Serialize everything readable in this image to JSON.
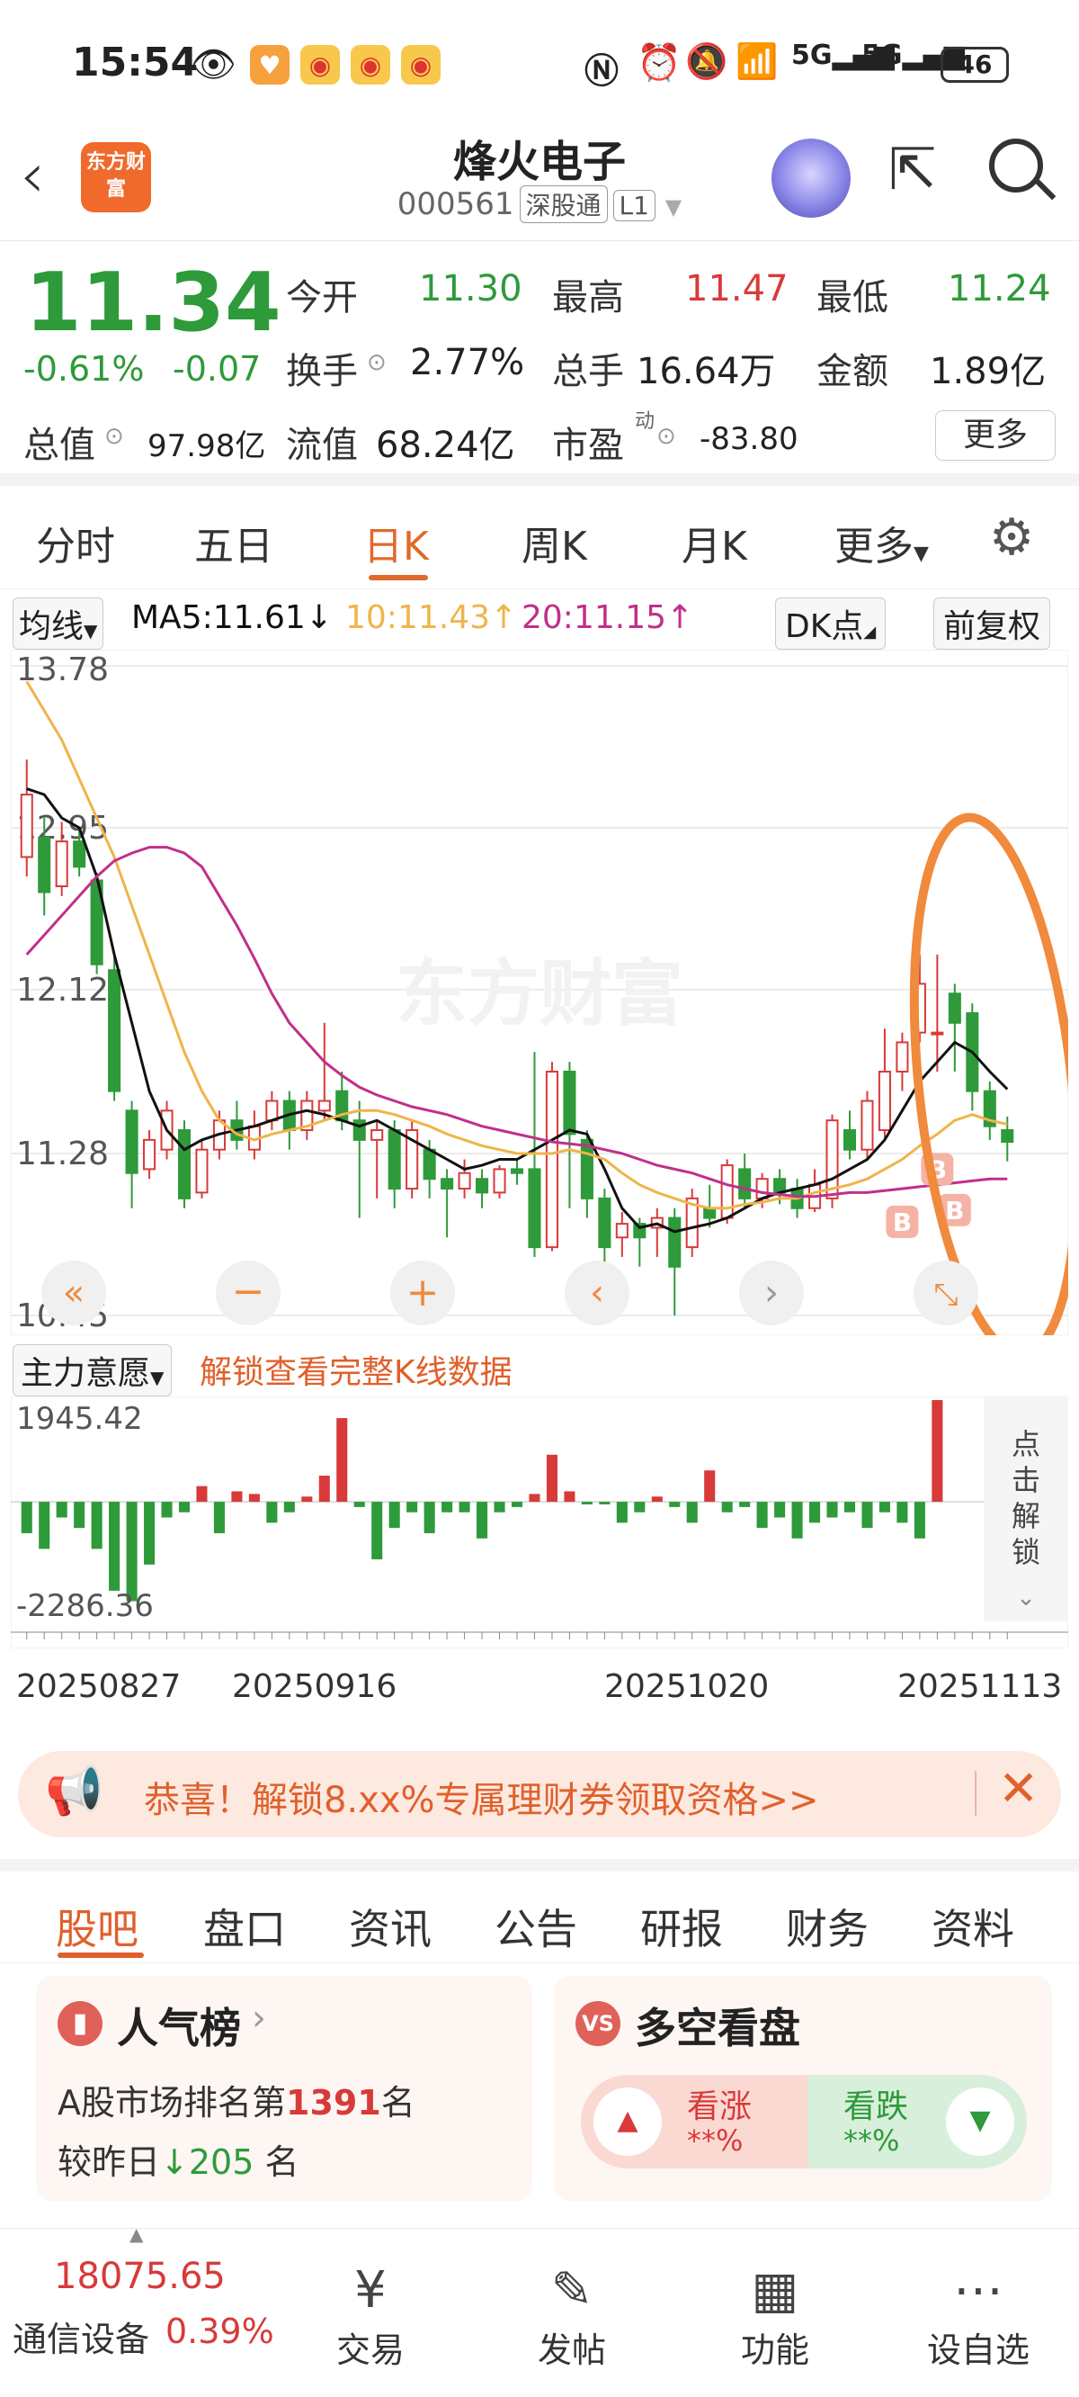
{
  "status_bar": {
    "time": "15:54",
    "battery": "46"
  },
  "header": {
    "stock_name": "烽火电子",
    "stock_code": "000561",
    "tag_connect": "深股通",
    "tag_level": "L1",
    "logo_text": "东方财富"
  },
  "quote": {
    "price": "11.34",
    "change_pct": "-0.61%",
    "change_abs": "-0.07",
    "open_label": "今开",
    "open": "11.30",
    "high_label": "最高",
    "high": "11.47",
    "low_label": "最低",
    "low": "11.24",
    "turnover_label": "换手",
    "turnover": "2.77%",
    "volume_label": "总手",
    "volume": "16.64万",
    "amount_label": "金额",
    "amount": "1.89亿",
    "mktcap_label": "总值",
    "mktcap": "97.98亿",
    "float_label": "流值",
    "float_cap": "68.24亿",
    "pe_label": "市盈",
    "pe_sup": "动",
    "pe": "-83.80",
    "more_label": "更多"
  },
  "kline_tabs": [
    "分时",
    "五日",
    "日K",
    "周K",
    "月K",
    "更多"
  ],
  "ma_bar": {
    "ma_type": "均线",
    "ma5": "MA5:11.61",
    "ma10": "10:11.43",
    "ma20": "20:11.15",
    "dk": "DK点",
    "adjust": "前复权"
  },
  "watermark": "东方财富",
  "sub_bar": {
    "indicator": "主力意愿",
    "unlock": "解锁查看完整K线数据"
  },
  "side_unlock": "点击解锁",
  "x_labels": [
    "20250827",
    "20250916",
    "20251020",
    "20251113"
  ],
  "chart_data": {
    "type": "candlestick",
    "y_ticks": [
      "13.78",
      "12.95",
      "12.12",
      "11.28",
      "10.45"
    ],
    "ylim": [
      10.45,
      13.78
    ],
    "candles": [
      [
        12.8,
        13.12,
        13.3,
        12.7
      ],
      [
        12.9,
        12.62,
        13.0,
        12.5
      ],
      [
        12.65,
        12.88,
        12.98,
        12.6
      ],
      [
        12.88,
        12.75,
        12.95,
        12.7
      ],
      [
        12.68,
        12.25,
        12.72,
        12.2
      ],
      [
        12.22,
        11.6,
        12.3,
        11.55
      ],
      [
        11.5,
        11.18,
        11.55,
        11.0
      ],
      [
        11.2,
        11.35,
        11.4,
        11.15
      ],
      [
        11.3,
        11.5,
        11.55,
        11.25
      ],
      [
        11.4,
        11.05,
        11.45,
        11.0
      ],
      [
        11.08,
        11.3,
        11.35,
        11.05
      ],
      [
        11.3,
        11.45,
        11.5,
        11.25
      ],
      [
        11.45,
        11.35,
        11.55,
        11.3
      ],
      [
        11.3,
        11.42,
        11.5,
        11.25
      ],
      [
        11.45,
        11.55,
        11.6,
        11.4
      ],
      [
        11.55,
        11.4,
        11.6,
        11.3
      ],
      [
        11.4,
        11.55,
        11.6,
        11.35
      ],
      [
        11.5,
        11.55,
        11.95,
        11.45
      ],
      [
        11.6,
        11.45,
        11.7,
        11.4
      ],
      [
        11.45,
        11.35,
        11.55,
        10.95
      ],
      [
        11.35,
        11.4,
        11.45,
        11.05
      ],
      [
        11.4,
        11.1,
        11.45,
        11.0
      ],
      [
        11.1,
        11.4,
        11.45,
        11.05
      ],
      [
        11.3,
        11.15,
        11.35,
        11.05
      ],
      [
        11.15,
        11.1,
        11.2,
        10.85
      ],
      [
        11.1,
        11.18,
        11.25,
        11.05
      ],
      [
        11.15,
        11.08,
        11.2,
        11.0
      ],
      [
        11.08,
        11.2,
        11.22,
        11.05
      ],
      [
        11.2,
        11.18,
        11.25,
        11.12
      ],
      [
        11.2,
        10.8,
        11.8,
        10.75
      ],
      [
        10.8,
        11.7,
        11.75,
        10.78
      ],
      [
        11.7,
        11.38,
        11.75,
        11.0
      ],
      [
        11.35,
        11.05,
        11.4,
        10.95
      ],
      [
        11.05,
        10.8,
        11.1,
        10.7
      ],
      [
        10.85,
        10.92,
        10.98,
        10.75
      ],
      [
        10.92,
        10.85,
        10.95,
        10.7
      ],
      [
        10.9,
        10.95,
        11.0,
        10.75
      ],
      [
        10.95,
        10.7,
        11.0,
        10.45
      ],
      [
        10.8,
        11.05,
        11.1,
        10.75
      ],
      [
        11.0,
        10.95,
        11.12,
        10.9
      ],
      [
        10.95,
        11.22,
        11.25,
        10.92
      ],
      [
        11.2,
        11.05,
        11.28,
        11.0
      ],
      [
        11.05,
        11.15,
        11.18,
        11.0
      ],
      [
        11.15,
        11.08,
        11.2,
        11.02
      ],
      [
        11.1,
        11.0,
        11.15,
        10.95
      ],
      [
        11.0,
        11.12,
        11.2,
        10.98
      ],
      [
        11.05,
        11.45,
        11.48,
        11.0
      ],
      [
        11.4,
        11.3,
        11.5,
        11.25
      ],
      [
        11.3,
        11.55,
        11.6,
        11.25
      ],
      [
        11.4,
        11.7,
        11.92,
        11.35
      ],
      [
        11.7,
        11.85,
        11.9,
        11.6
      ],
      [
        11.9,
        12.15,
        12.3,
        11.85
      ],
      [
        11.9,
        11.9,
        12.3,
        11.7
      ],
      [
        12.1,
        11.95,
        12.15,
        11.7
      ],
      [
        12.0,
        11.6,
        12.05,
        11.5
      ],
      [
        11.6,
        11.42,
        11.65,
        11.35
      ],
      [
        11.4,
        11.34,
        11.47,
        11.24
      ]
    ],
    "ma5_line": [
      13.15,
      13.12,
      13.0,
      12.95,
      12.7,
      12.3,
      11.95,
      11.6,
      11.4,
      11.3,
      11.35,
      11.38,
      11.4,
      11.42,
      11.45,
      11.48,
      11.5,
      11.48,
      11.45,
      11.42,
      11.45,
      11.4,
      11.35,
      11.3,
      11.25,
      11.2,
      11.22,
      11.25,
      11.25,
      11.3,
      11.35,
      11.4,
      11.38,
      11.2,
      11.0,
      10.9,
      10.92,
      10.88,
      10.9,
      10.92,
      10.95,
      11.0,
      11.05,
      11.08,
      11.1,
      11.12,
      11.15,
      11.2,
      11.25,
      11.35,
      11.5,
      11.65,
      11.75,
      11.85,
      11.8,
      11.7,
      11.61
    ],
    "ma10_line": [
      13.7,
      13.55,
      13.4,
      13.2,
      13.0,
      12.8,
      12.55,
      12.3,
      12.05,
      11.8,
      11.6,
      11.45,
      11.38,
      11.35,
      11.38,
      11.4,
      11.42,
      11.45,
      11.48,
      11.5,
      11.5,
      11.48,
      11.45,
      11.42,
      11.38,
      11.35,
      11.32,
      11.3,
      11.28,
      11.28,
      11.28,
      11.3,
      11.28,
      11.25,
      11.18,
      11.12,
      11.08,
      11.05,
      11.02,
      11.0,
      11.0,
      11.02,
      11.03,
      11.05,
      11.05,
      11.08,
      11.1,
      11.12,
      11.15,
      11.2,
      11.25,
      11.32,
      11.38,
      11.45,
      11.48,
      11.45,
      11.43
    ],
    "ma20_line": [
      12.3,
      12.4,
      12.5,
      12.6,
      12.7,
      12.78,
      12.82,
      12.85,
      12.85,
      12.82,
      12.75,
      12.6,
      12.45,
      12.28,
      12.1,
      11.95,
      11.85,
      11.75,
      11.68,
      11.62,
      11.58,
      11.55,
      11.52,
      11.5,
      11.48,
      11.45,
      11.42,
      11.4,
      11.38,
      11.36,
      11.34,
      11.33,
      11.32,
      11.3,
      11.28,
      11.25,
      11.22,
      11.2,
      11.18,
      11.15,
      11.12,
      11.1,
      11.08,
      11.07,
      11.06,
      11.06,
      11.07,
      11.08,
      11.08,
      11.09,
      11.1,
      11.11,
      11.12,
      11.13,
      11.14,
      11.15,
      11.15
    ],
    "volume_ylim": [
      -2286.36,
      1945.42
    ],
    "volume_ticks": [
      "1945.42",
      "-2286.36"
    ],
    "volume": [
      -600,
      -900,
      -300,
      -500,
      -900,
      -1700,
      -1900,
      -1200,
      -300,
      -200,
      300,
      -600,
      200,
      150,
      -400,
      -200,
      100,
      500,
      1600,
      -100,
      -1100,
      -500,
      -200,
      -600,
      -200,
      -200,
      -700,
      -200,
      -100,
      150,
      900,
      200,
      -50,
      -50,
      -400,
      -200,
      100,
      -100,
      -400,
      600,
      -200,
      -100,
      -500,
      -300,
      -700,
      -400,
      -300,
      -200,
      -500,
      -200,
      -400,
      -700,
      1945,
      0,
      0,
      0,
      0
    ],
    "markers": [
      "B",
      "B",
      "B"
    ]
  },
  "promo": {
    "text": "恭喜！解锁8.xx%专属理财券领取资格>>"
  },
  "bottom_tabs": [
    "股吧",
    "盘口",
    "资讯",
    "公告",
    "研报",
    "财务",
    "资料"
  ],
  "popularity_card": {
    "title": "人气榜",
    "rank_prefix": "A股市场排名第",
    "rank": "1391",
    "rank_suffix": "名",
    "change_prefix": "较昨日",
    "change": "205",
    "change_suffix": "名"
  },
  "vote_card": {
    "title": "多空看盘",
    "up_label": "看涨",
    "up_value": "**%",
    "down_label": "看跌",
    "down_value": "**%"
  },
  "bottom_nav": {
    "index_value": "18075.65",
    "index_name": "通信设备",
    "index_change": "0.39%",
    "items": [
      "交易",
      "发帖",
      "功能",
      "设自选"
    ]
  },
  "colors": {
    "up": "#d83a3a",
    "down": "#2e9a3a",
    "ma5": "#111111",
    "ma10": "#f0b44a",
    "ma20": "#c0308a",
    "accent": "#e06a2b"
  }
}
